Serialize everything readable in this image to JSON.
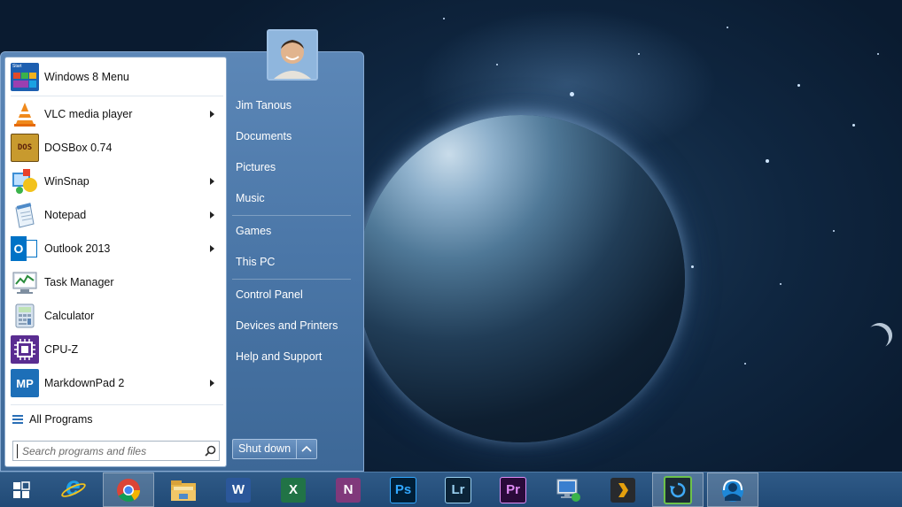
{
  "start_menu": {
    "pinned_programs": [
      {
        "label": "Windows 8 Menu",
        "has_submenu": false,
        "icon": "windows8-menu-icon"
      },
      {
        "label": "VLC media player",
        "has_submenu": true,
        "icon": "vlc-icon"
      },
      {
        "label": "DOSBox 0.74",
        "has_submenu": false,
        "icon": "dosbox-icon"
      },
      {
        "label": "WinSnap",
        "has_submenu": true,
        "icon": "winsnap-icon"
      },
      {
        "label": "Notepad",
        "has_submenu": true,
        "icon": "notepad-icon"
      },
      {
        "label": "Outlook 2013",
        "has_submenu": true,
        "icon": "outlook-icon"
      },
      {
        "label": "Task Manager",
        "has_submenu": false,
        "icon": "task-manager-icon"
      },
      {
        "label": "Calculator",
        "has_submenu": false,
        "icon": "calculator-icon"
      },
      {
        "label": "CPU-Z",
        "has_submenu": false,
        "icon": "cpuz-icon"
      },
      {
        "label": "MarkdownPad 2",
        "has_submenu": true,
        "icon": "markdownpad-icon"
      }
    ],
    "all_programs_label": "All Programs",
    "search_placeholder": "Search programs and files",
    "right_items": [
      "Jim Tanous",
      "Documents",
      "Pictures",
      "Music",
      "Games",
      "This PC",
      "Control Panel",
      "Devices and Printers",
      "Help and Support"
    ],
    "shutdown_label": "Shut down",
    "icon_text": {
      "win8_tile": "Start",
      "dosbox": "DOS",
      "outlook": "O",
      "markdownpad": "MP"
    }
  },
  "taskbar": {
    "apps": [
      {
        "name": "internet-explorer",
        "icon": "ie-icon",
        "text": "e"
      },
      {
        "name": "chrome",
        "icon": "chrome-icon",
        "active": true
      },
      {
        "name": "file-explorer",
        "icon": "folder-icon"
      },
      {
        "name": "word",
        "icon": "word-icon",
        "text": "W"
      },
      {
        "name": "excel",
        "icon": "excel-icon",
        "text": "X"
      },
      {
        "name": "onenote",
        "icon": "onenote-icon",
        "text": "N"
      },
      {
        "name": "photoshop",
        "icon": "photoshop-icon",
        "text": "Ps"
      },
      {
        "name": "lightroom",
        "icon": "lightroom-icon",
        "text": "Lr"
      },
      {
        "name": "premiere",
        "icon": "premiere-icon",
        "text": "Pr"
      },
      {
        "name": "remote-desktop",
        "icon": "remote-desktop-icon"
      },
      {
        "name": "plex",
        "icon": "plex-icon"
      },
      {
        "name": "sync-app",
        "icon": "sync-icon",
        "active": true
      },
      {
        "name": "teamspeak",
        "icon": "teamspeak-icon",
        "active": true
      }
    ]
  },
  "colors": {
    "start_menu_blue": "#4a76a7",
    "taskbar_blue": "#2a5380",
    "photoshop": "#001e36",
    "lightroom": "#0b2438",
    "premiere": "#2a0a3a"
  }
}
